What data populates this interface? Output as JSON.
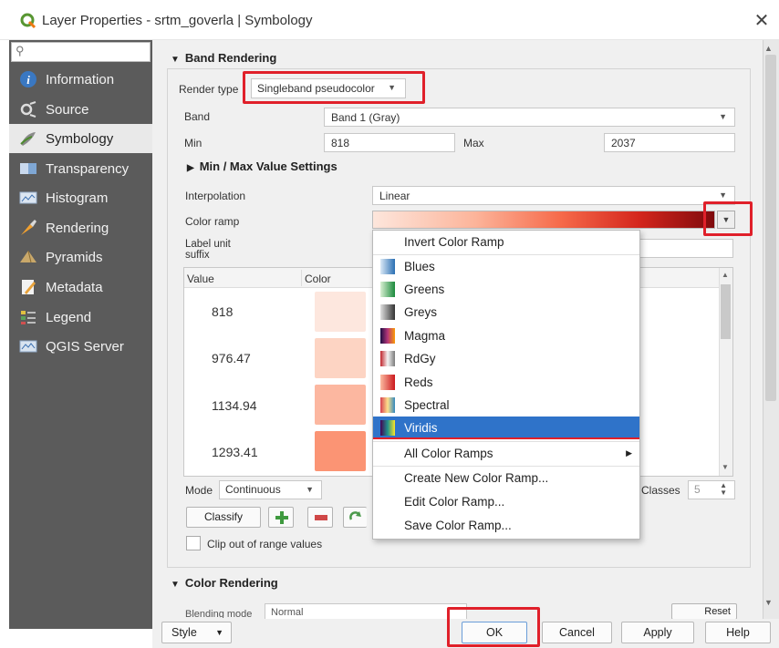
{
  "window": {
    "title": "Layer Properties - srtm_goverla | Symbology",
    "close_icon": "close-icon"
  },
  "sidebar": {
    "search_placeholder": "",
    "items": [
      {
        "label": "Information",
        "icon": "information-icon"
      },
      {
        "label": "Source",
        "icon": "source-icon"
      },
      {
        "label": "Symbology",
        "icon": "symbology-icon",
        "active": true
      },
      {
        "label": "Transparency",
        "icon": "transparency-icon"
      },
      {
        "label": "Histogram",
        "icon": "histogram-icon"
      },
      {
        "label": "Rendering",
        "icon": "rendering-icon"
      },
      {
        "label": "Pyramids",
        "icon": "pyramids-icon"
      },
      {
        "label": "Metadata",
        "icon": "metadata-icon"
      },
      {
        "label": "Legend",
        "icon": "legend-icon"
      },
      {
        "label": "QGIS Server",
        "icon": "qgis-server-icon"
      }
    ]
  },
  "band_rendering": {
    "header": "Band Rendering",
    "render_type_label": "Render type",
    "render_type_value": "Singleband pseudocolor",
    "band_label": "Band",
    "band_value": "Band 1 (Gray)",
    "min_label": "Min",
    "min_value": "818",
    "max_label": "Max",
    "max_value": "2037",
    "minmax_header": "Min / Max Value Settings",
    "interpolation_label": "Interpolation",
    "interpolation_value": "Linear",
    "color_ramp_label": "Color ramp",
    "label_unit_label_1": "Label unit",
    "label_unit_label_2": "suffix",
    "table_headers": {
      "value": "Value",
      "color": "Color"
    },
    "rows": [
      {
        "value": "818",
        "color": "#fde7de"
      },
      {
        "value": "976.47",
        "color": "#fdd4c3"
      },
      {
        "value": "1134.94",
        "color": "#fcb7a0"
      },
      {
        "value": "1293.41",
        "color": "#fb9474"
      }
    ],
    "mode_label": "Mode",
    "mode_value": "Continuous",
    "classes_label": "Classes",
    "classes_value": "5",
    "classify_label": "Classify",
    "clip_label": "Clip out of range values"
  },
  "color_ramp_menu": {
    "invert": "Invert Color Ramp",
    "ramps": [
      {
        "name": "Blues",
        "gradient": [
          "#dbe9f6",
          "#2a6fb3"
        ]
      },
      {
        "name": "Greens",
        "gradient": [
          "#d9f0d3",
          "#1b8a3c"
        ]
      },
      {
        "name": "Greys",
        "gradient": [
          "#e0e0e0",
          "#333333"
        ]
      },
      {
        "name": "Magma",
        "gradient": [
          "#1b0c41",
          "#b5367a",
          "#fb9b06"
        ]
      },
      {
        "name": "RdGy",
        "gradient": [
          "#c0242b",
          "#f4f4f4",
          "#7a7a7a"
        ]
      },
      {
        "name": "Reds",
        "gradient": [
          "#fcbba1",
          "#cb181d"
        ]
      },
      {
        "name": "Spectral",
        "gradient": [
          "#d53e4f",
          "#fee08b",
          "#3288bd"
        ]
      },
      {
        "name": "Viridis",
        "gradient": [
          "#440154",
          "#21918c",
          "#fde725"
        ],
        "selected": true
      }
    ],
    "all_ramps": "All Color Ramps",
    "create": "Create New Color Ramp...",
    "edit": "Edit Color Ramp...",
    "save": "Save Color Ramp..."
  },
  "color_rendering": {
    "header": "Color Rendering",
    "blending_label": "Blending mode",
    "blending_value": "Normal",
    "reset_label": "Reset"
  },
  "buttons": {
    "style": "Style",
    "ok": "OK",
    "cancel": "Cancel",
    "apply": "Apply",
    "help": "Help"
  },
  "highlight_color": "#e0202a",
  "selection_color": "#2f73c9"
}
